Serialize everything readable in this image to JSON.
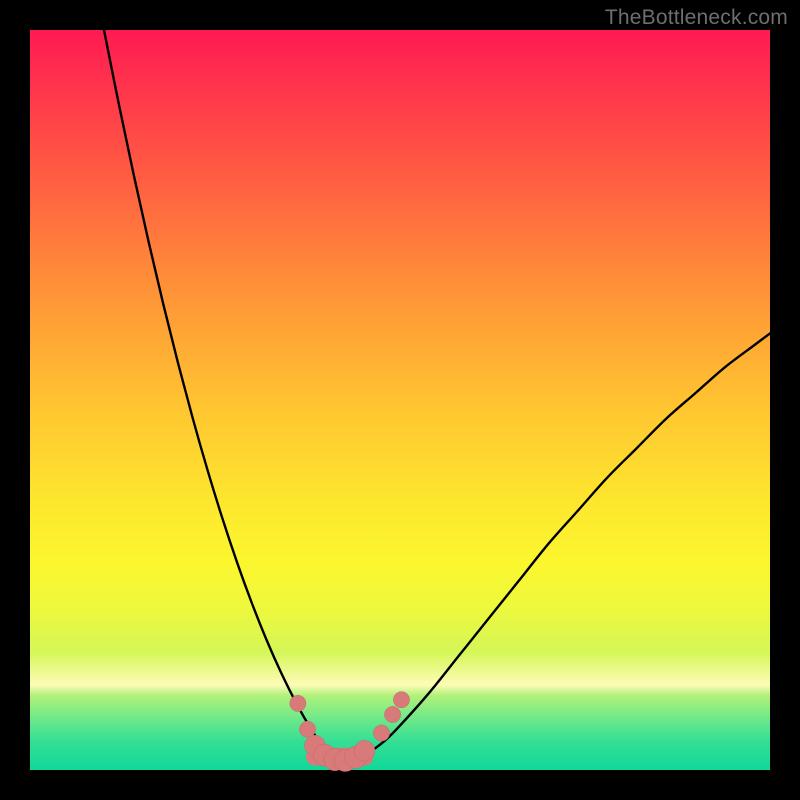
{
  "watermark": "TheBottleneck.com",
  "colors": {
    "frame": "#000000",
    "curve": "#000000",
    "marker_fill": "#d97a7a",
    "marker_stroke": "#c26868"
  },
  "chart_data": {
    "type": "line",
    "title": "",
    "xlabel": "",
    "ylabel": "",
    "xlim": [
      0,
      100
    ],
    "ylim": [
      0,
      100
    ],
    "grid": false,
    "legend": false,
    "series": [
      {
        "name": "left-branch",
        "x": [
          10,
          12,
          14,
          16,
          18,
          20,
          22,
          24,
          26,
          28,
          30,
          32,
          34,
          36,
          38,
          40,
          41
        ],
        "y": [
          100,
          90,
          80.5,
          71.5,
          63,
          55,
          47.5,
          40.5,
          34,
          28,
          22.5,
          17.5,
          13,
          9,
          5.5,
          2.5,
          1.5
        ]
      },
      {
        "name": "right-branch",
        "x": [
          44,
          46,
          48,
          50,
          54,
          58,
          62,
          66,
          70,
          74,
          78,
          82,
          86,
          90,
          94,
          98,
          100
        ],
        "y": [
          1.5,
          2.5,
          4,
          6,
          10.5,
          15.5,
          20.5,
          25.5,
          30.5,
          35,
          39.5,
          43.5,
          47.5,
          51,
          54.5,
          57.5,
          59
        ]
      }
    ],
    "markers": [
      {
        "x": 36.2,
        "y": 9.0,
        "r": 1.1
      },
      {
        "x": 37.5,
        "y": 5.5,
        "r": 1.1
      },
      {
        "x": 38.5,
        "y": 3.3,
        "r": 1.4
      },
      {
        "x": 39.8,
        "y": 2.0,
        "r": 1.5
      },
      {
        "x": 41.2,
        "y": 1.4,
        "r": 1.5
      },
      {
        "x": 42.6,
        "y": 1.3,
        "r": 1.5
      },
      {
        "x": 44.0,
        "y": 1.7,
        "r": 1.5
      },
      {
        "x": 45.2,
        "y": 2.6,
        "r": 1.4
      },
      {
        "x": 47.5,
        "y": 5.0,
        "r": 1.1
      },
      {
        "x": 49.0,
        "y": 7.5,
        "r": 1.1
      },
      {
        "x": 50.2,
        "y": 9.5,
        "r": 1.1
      }
    ],
    "bottom_segment": {
      "x0": 38.5,
      "x1": 45.2,
      "y": 1.8,
      "thickness": 2.4
    }
  }
}
